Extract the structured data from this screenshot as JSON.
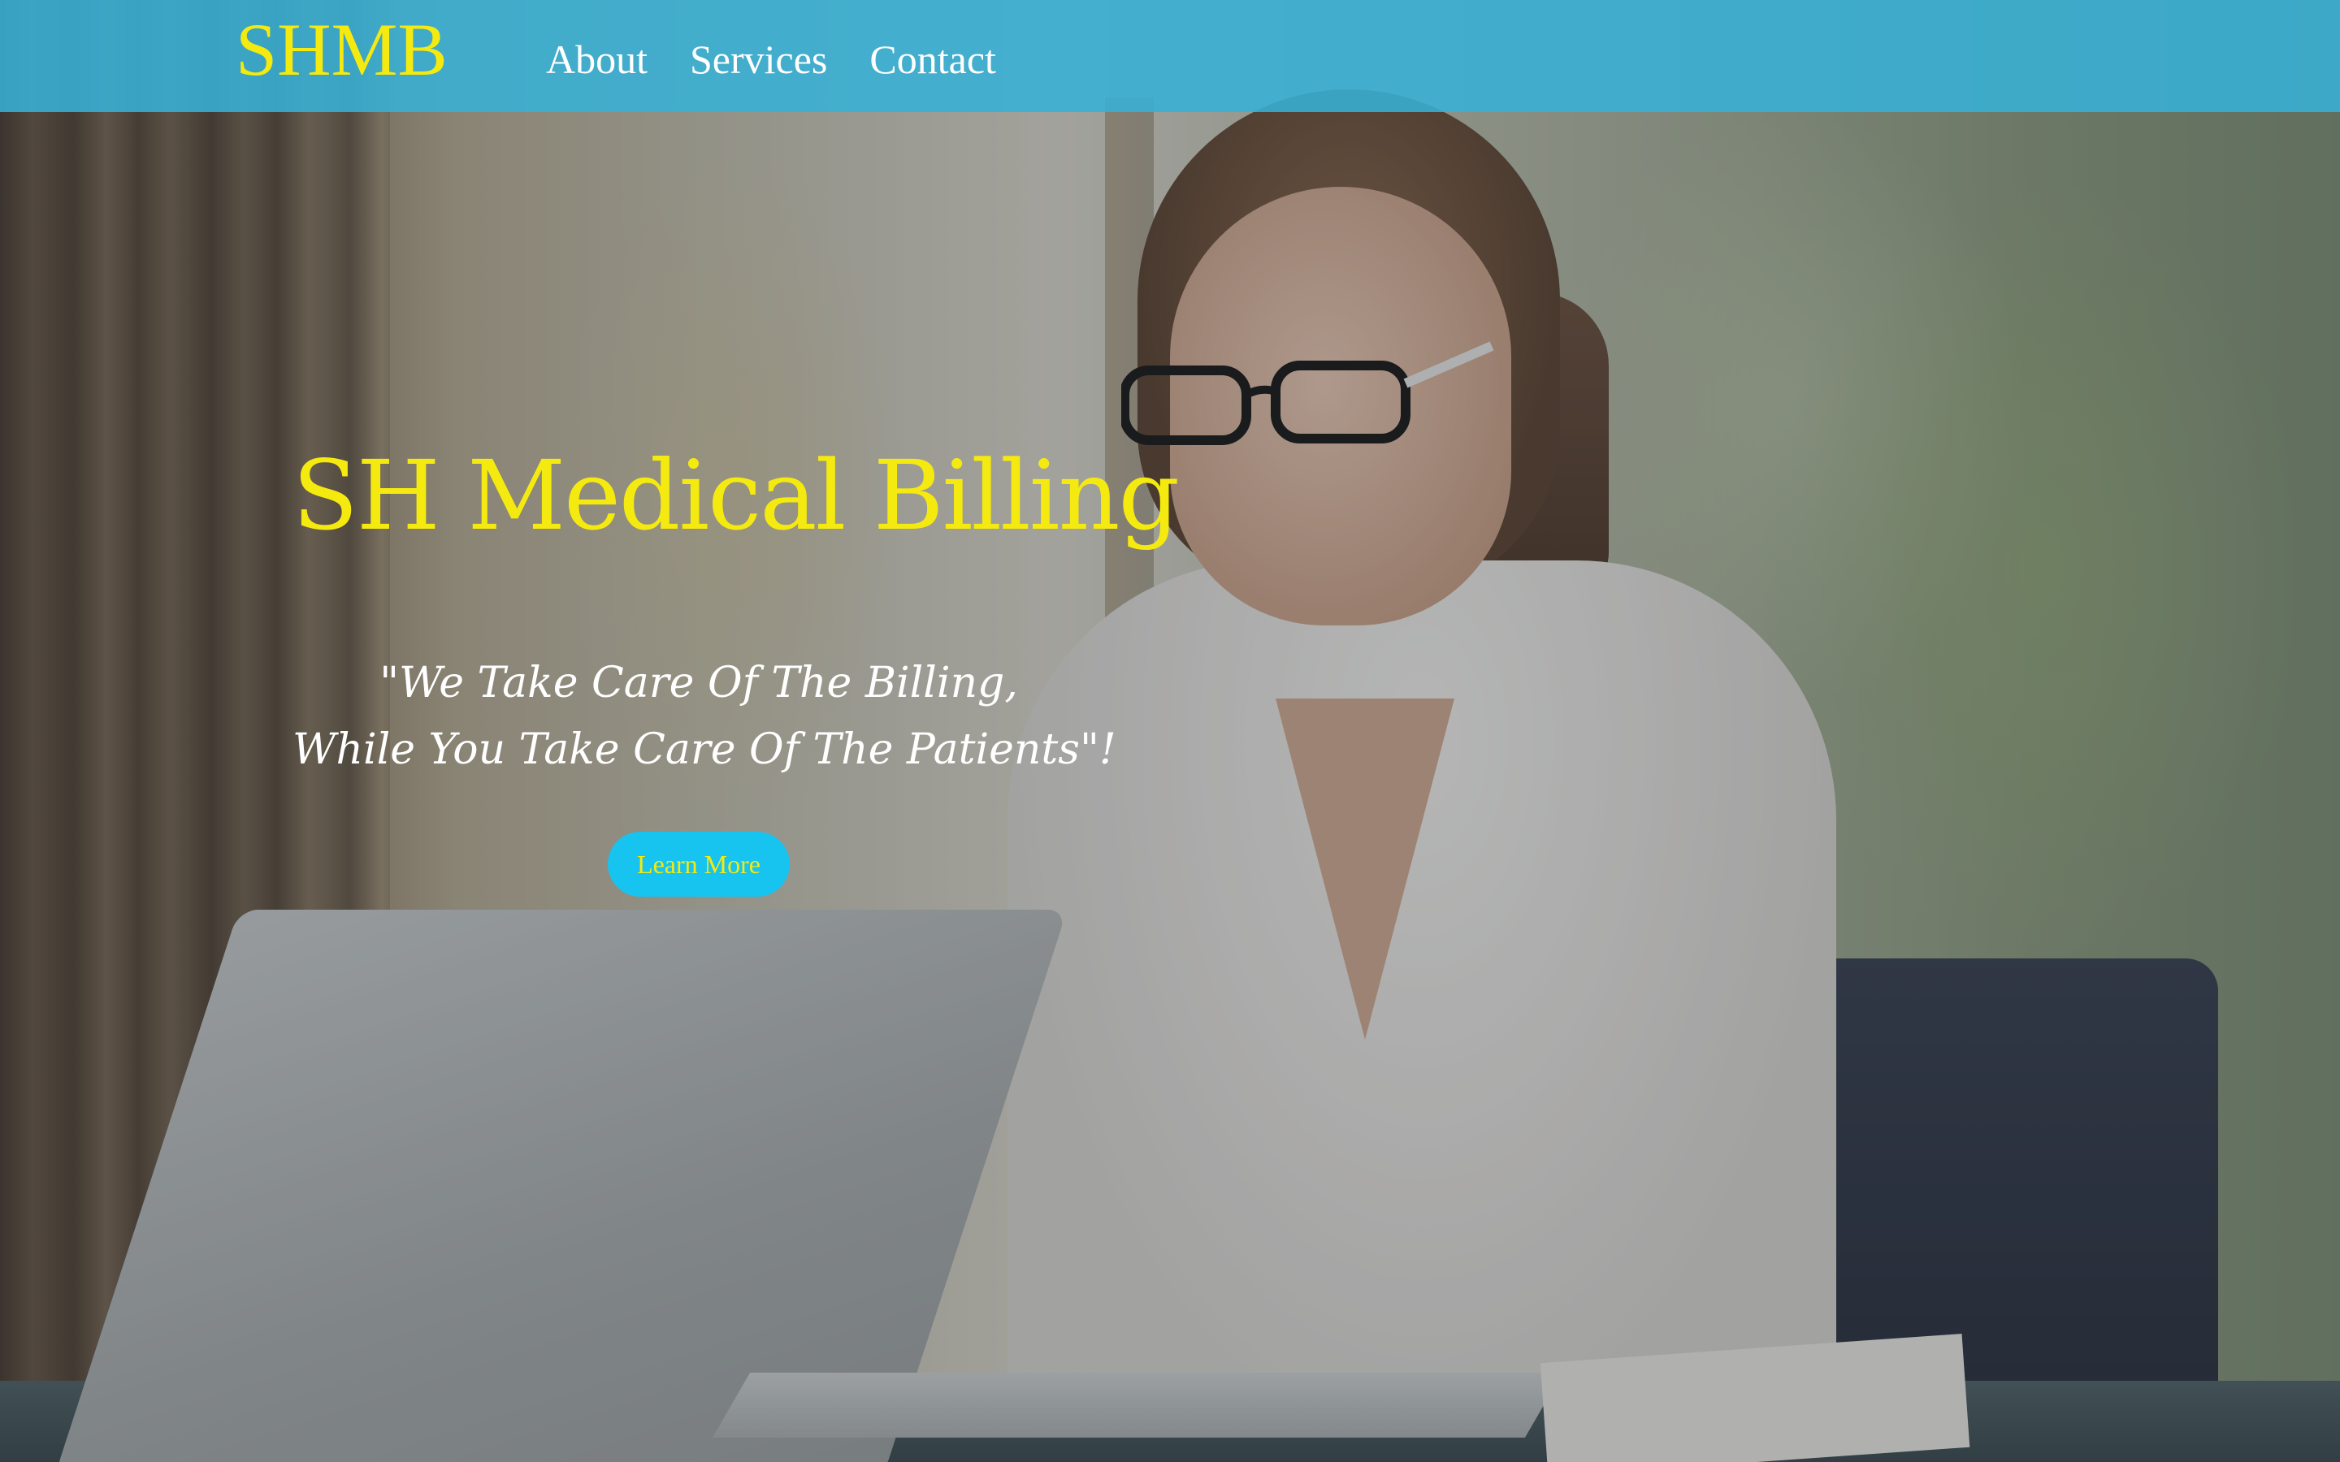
{
  "navbar": {
    "brand": "SHMB",
    "links": [
      {
        "label": "About"
      },
      {
        "label": "Services"
      },
      {
        "label": "Contact"
      }
    ],
    "background_color": "#38b0d6"
  },
  "hero": {
    "title": "SH Medical Billing",
    "tagline_line1": "\"We Take Care Of The Billing,",
    "tagline_line2": "While You Take Care Of The Patients\"!",
    "cta_label": "Learn More",
    "accent_color": "#f5ea10",
    "button_color": "#17c4f0"
  }
}
